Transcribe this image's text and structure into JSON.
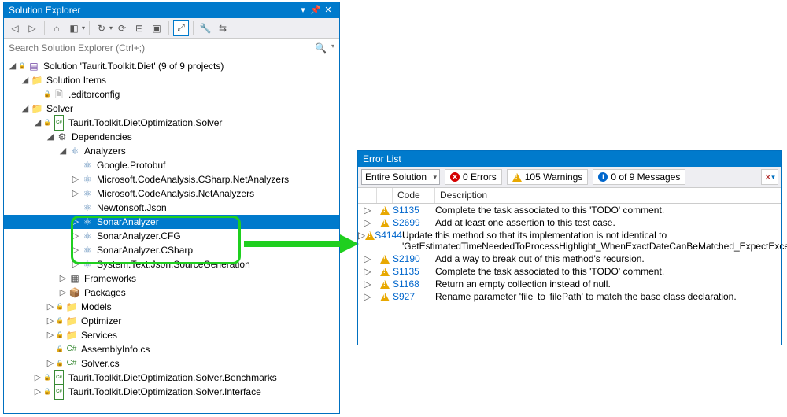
{
  "solutionExplorer": {
    "title": "Solution Explorer",
    "searchPlaceholder": "Search Solution Explorer (Ctrl+;)",
    "rootLabel": "Solution 'Taurit.Toolkit.Diet' (9 of 9 projects)",
    "nodes": [
      {
        "depth": 0,
        "exp": "open",
        "icon": "solution",
        "label": "Solution 'Taurit.Toolkit.Diet' (9 of 9 projects)",
        "lock": true
      },
      {
        "depth": 1,
        "exp": "open",
        "icon": "folder",
        "label": "Solution Items"
      },
      {
        "depth": 2,
        "exp": "none",
        "icon": "doc",
        "label": ".editorconfig",
        "lock": true
      },
      {
        "depth": 1,
        "exp": "open",
        "icon": "folder",
        "label": "Solver"
      },
      {
        "depth": 2,
        "exp": "open",
        "icon": "csproj",
        "label": "Taurit.Toolkit.DietOptimization.Solver",
        "lock": true
      },
      {
        "depth": 3,
        "exp": "open",
        "icon": "dep",
        "label": "Dependencies"
      },
      {
        "depth": 4,
        "exp": "open",
        "icon": "analyzers",
        "label": "Analyzers"
      },
      {
        "depth": 5,
        "exp": "none",
        "icon": "analyzer",
        "label": "Google.Protobuf"
      },
      {
        "depth": 5,
        "exp": "closed",
        "icon": "analyzer",
        "label": "Microsoft.CodeAnalysis.CSharp.NetAnalyzers"
      },
      {
        "depth": 5,
        "exp": "closed",
        "icon": "analyzer",
        "label": "Microsoft.CodeAnalysis.NetAnalyzers"
      },
      {
        "depth": 5,
        "exp": "none",
        "icon": "analyzer",
        "label": "Newtonsoft.Json"
      },
      {
        "depth": 5,
        "exp": "closed",
        "icon": "analyzer",
        "label": "SonarAnalyzer",
        "selected": true
      },
      {
        "depth": 5,
        "exp": "closed",
        "icon": "analyzer",
        "label": "SonarAnalyzer.CFG"
      },
      {
        "depth": 5,
        "exp": "closed",
        "icon": "analyzer",
        "label": "SonarAnalyzer.CSharp"
      },
      {
        "depth": 5,
        "exp": "closed",
        "icon": "analyzer",
        "label": "System.Text.Json.SourceGeneration"
      },
      {
        "depth": 4,
        "exp": "closed",
        "icon": "frameworks",
        "label": "Frameworks"
      },
      {
        "depth": 4,
        "exp": "closed",
        "icon": "packages",
        "label": "Packages"
      },
      {
        "depth": 3,
        "exp": "closed",
        "icon": "folder",
        "label": "Models",
        "lock": true
      },
      {
        "depth": 3,
        "exp": "closed",
        "icon": "folder",
        "label": "Optimizer",
        "lock": true
      },
      {
        "depth": 3,
        "exp": "closed",
        "icon": "folder",
        "label": "Services",
        "lock": true
      },
      {
        "depth": 3,
        "exp": "none",
        "icon": "csfile",
        "label": "AssemblyInfo.cs",
        "lock": true
      },
      {
        "depth": 3,
        "exp": "closed",
        "icon": "csfile",
        "label": "Solver.cs",
        "lock": true
      },
      {
        "depth": 2,
        "exp": "closed",
        "icon": "csproj",
        "label": "Taurit.Toolkit.DietOptimization.Solver.Benchmarks",
        "lock": true
      },
      {
        "depth": 2,
        "exp": "closed",
        "icon": "csproj",
        "label": "Taurit.Toolkit.DietOptimization.Solver.Interface",
        "lock": true
      }
    ]
  },
  "errorList": {
    "title": "Error List",
    "scopeLabel": "Entire Solution",
    "errorsLabel": "0 Errors",
    "warningsLabel": "105 Warnings",
    "messagesLabel": "0 of 9 Messages",
    "headers": {
      "code": "Code",
      "description": "Description"
    },
    "rows": [
      {
        "code": "S1135",
        "desc": "Complete the task associated to this 'TODO' comment."
      },
      {
        "code": "S2699",
        "desc": "Add at least one assertion to this test case."
      },
      {
        "code": "S4144",
        "desc": "Update this method so that its implementation is not identical to 'GetEstimatedTimeNeededToProcessHighlight_WhenExactDateCanBeMatched_ExpectExceptionIsNotThrown'."
      },
      {
        "code": "S2190",
        "desc": "Add a way to break out of this method's recursion."
      },
      {
        "code": "S1135",
        "desc": "Complete the task associated to this 'TODO' comment."
      },
      {
        "code": "S1168",
        "desc": "Return an empty collection instead of null."
      },
      {
        "code": "S927",
        "desc": "Rename parameter 'file' to 'filePath' to match the base class declaration."
      }
    ]
  }
}
